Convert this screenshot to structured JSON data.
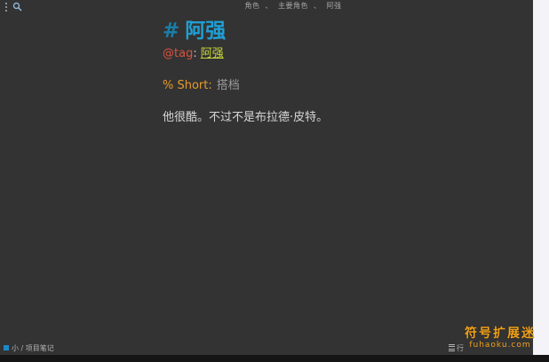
{
  "topbar": {
    "breadcrumb": [
      "角色",
      "主要角色",
      "阿强"
    ],
    "breadcrumb_separator": "、",
    "menu_icon": "vertical-dots-icon",
    "search_icon": "search-icon"
  },
  "note": {
    "title_marker": "#",
    "title": "阿强",
    "tag_key": "@tag",
    "tag_colon": ":",
    "tag_value": "阿强",
    "short_key": "% Short:",
    "short_value": "搭档",
    "body": "他很酷。不过不是布拉德·皮特。"
  },
  "statusbar": {
    "left": "小 / 项目笔记",
    "right": "行"
  },
  "watermark": {
    "main": "符号扩展迷",
    "sub": "fuhaoku.com"
  },
  "colors": {
    "background": "#333333",
    "title": "#1f9fd4",
    "tag_key": "#d9533f",
    "tag_value": "#c7d63a",
    "short_key": "#e79b2b",
    "accent": "#1e88c8",
    "watermark": "#f1a21b"
  }
}
